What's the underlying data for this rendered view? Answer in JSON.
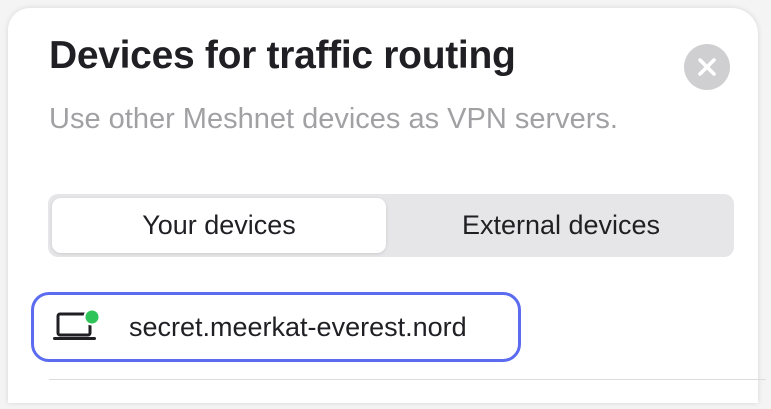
{
  "header": {
    "title": "Devices for traffic routing",
    "subtitle": "Use other Meshnet devices as VPN servers."
  },
  "close_button": {
    "icon": "close-icon"
  },
  "tabs": [
    {
      "label": "Your devices",
      "selected": true
    },
    {
      "label": "External devices",
      "selected": false
    }
  ],
  "devices": [
    {
      "name": "secret.meerkat-everest.nord",
      "icon": "laptop-icon",
      "status": "online",
      "selected": true
    }
  ],
  "colors": {
    "accent": "#5b6cf0",
    "online": "#2fc45a",
    "close_bg": "#cfcfd1",
    "subtitle": "#a1a1a4"
  }
}
